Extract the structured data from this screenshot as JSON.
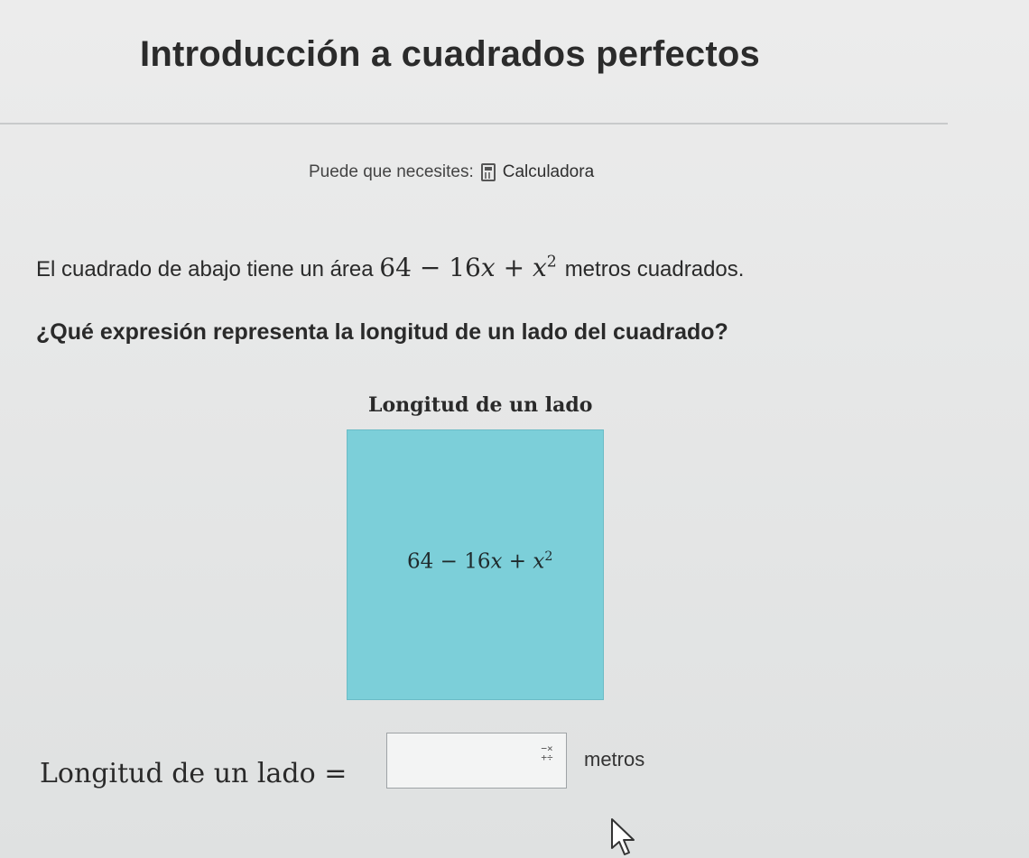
{
  "header": {
    "title": "Introducción a cuadrados perfectos"
  },
  "tools": {
    "prefix": "Puede que necesites:",
    "calculator_label": "Calculadora",
    "calculator_icon": "calculator-icon"
  },
  "problem": {
    "statement_before": "El cuadrado de abajo tiene un área",
    "area_expression": {
      "const": "64",
      "minus": "−",
      "coef": "16",
      "var": "x",
      "plus": "+",
      "var2": "x",
      "exp": "2"
    },
    "statement_after": "metros cuadrados.",
    "question": "¿Qué expresión representa la longitud de un lado del cuadrado?"
  },
  "figure": {
    "caption": "Longitud de un lado",
    "inner_label": {
      "const": "64",
      "minus": "−",
      "coef": "16",
      "var": "x",
      "plus": "+",
      "var2": "x",
      "exp": "2"
    },
    "fill_color": "#7ccfd9"
  },
  "answer": {
    "label": "Longitud de un lado",
    "equals": "=",
    "value": "",
    "placeholder": "",
    "units": "metros",
    "keypad_icon": "math-keypad-icon"
  }
}
